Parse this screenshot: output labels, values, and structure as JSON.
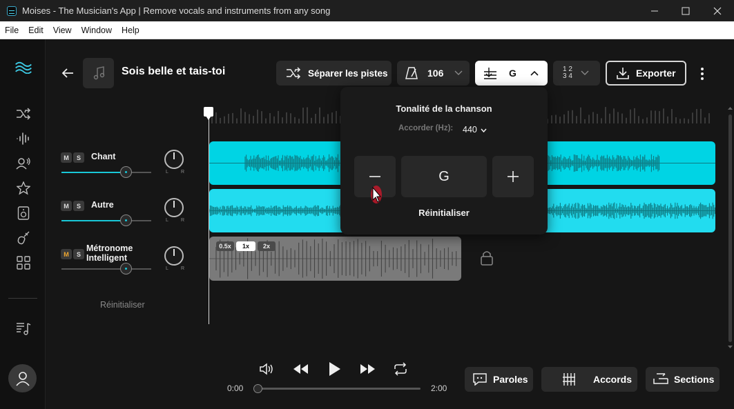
{
  "window": {
    "title": "Moises - The Musician's App | Remove vocals and instruments from any song",
    "controls": [
      "minimize",
      "maximize",
      "close"
    ]
  },
  "menu": [
    "File",
    "Edit",
    "View",
    "Window",
    "Help"
  ],
  "sidebar": {
    "items": [
      "logo",
      "separate-icon",
      "waveform-icon",
      "voice-icon",
      "star-icon",
      "speaker-icon",
      "guitar-icon",
      "apps-icon",
      "playlist-icon",
      "user-icon"
    ]
  },
  "header": {
    "song_title": "Sois belle et tais-toi",
    "separate_label": "Séparer les pistes",
    "bpm": "106",
    "key": "G",
    "time_signature_top": "1 2",
    "time_signature_bottom": "3 4",
    "export_label": "Exporter"
  },
  "tracks": [
    {
      "name": "Chant",
      "mute": "M",
      "solo": "S",
      "volume": 0.8,
      "pan_left": "L",
      "pan_right": "R"
    },
    {
      "name": "Autre",
      "mute": "M",
      "solo": "S",
      "volume": 0.8,
      "pan_left": "L",
      "pan_right": "R"
    },
    {
      "name_line1": "Métronome",
      "name_line2": "Intelligent",
      "mute": "M",
      "solo": "S",
      "volume": 0.8,
      "pan_left": "L",
      "pan_right": "R"
    }
  ],
  "mixer_reset": "Réinitialiser",
  "speeds": [
    "0.5x",
    "1x",
    "2x"
  ],
  "selected_speed": "1x",
  "key_popover": {
    "title": "Tonalité de la chanson",
    "tune_label": "Accorder (Hz):",
    "tune_value": "440",
    "minus": "–",
    "key": "G",
    "plus": "+",
    "reset": "Réinitialiser"
  },
  "player": {
    "current_time": "0:00",
    "duration": "2:00",
    "progress": 0.0
  },
  "bottom_buttons": {
    "lyrics": "Paroles",
    "chords": "Accords",
    "sections": "Sections"
  },
  "colors": {
    "accent": "#19c8d8",
    "lane_vocals": "#00d4e4",
    "lane_other": "#22dcef",
    "wave": "#0f7a82",
    "lane_metronome": "#7a7a7a"
  }
}
